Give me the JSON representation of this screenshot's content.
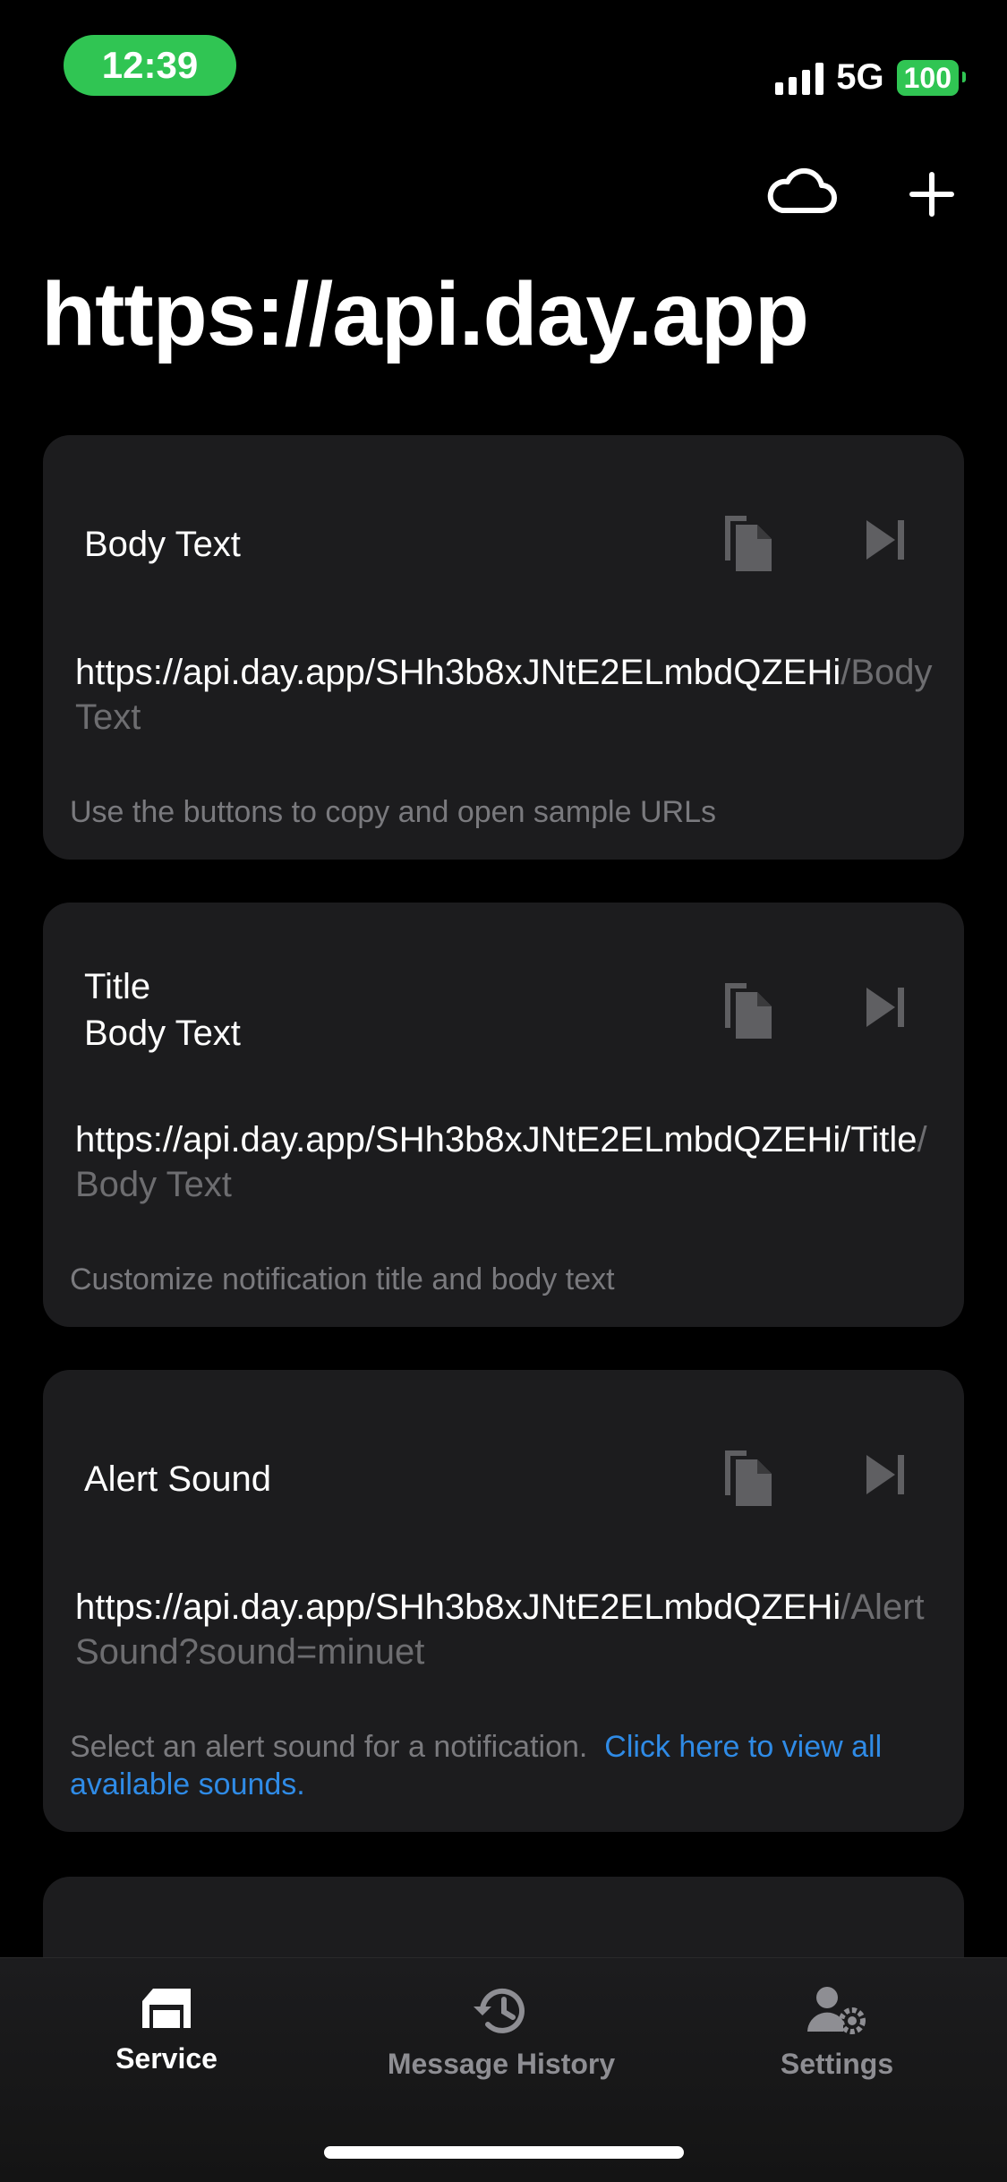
{
  "status": {
    "time": "12:39",
    "network": "5G",
    "battery": "100"
  },
  "header": {
    "title": "https://api.day.app"
  },
  "cards": [
    {
      "title": "Body Text",
      "url_base": "https://api.day.app/SHh3b8xJNtE2ELmbdQZEHi",
      "url_suffix": "/Body Text",
      "description": "Use the buttons to copy and open sample URLs"
    },
    {
      "title": "Title\nBody Text",
      "url_base": "https://api.day.app/SHh3b8xJNtE2ELmbdQZEHi/Title",
      "url_suffix": "/Body Text",
      "description": "Customize notification title and body text"
    },
    {
      "title": "Alert Sound",
      "url_base": "https://api.day.app/SHh3b8xJNtE2ELmbdQZEHi",
      "url_suffix": "/Alert Sound",
      "url_extra": "?sound=minuet",
      "description": "Select an alert sound for a notification.",
      "link": "Click here to view all available sounds."
    }
  ],
  "icons": {
    "cloud": "cloud-icon",
    "plus": "plus-icon",
    "copy": "copy-icon",
    "open": "skip-forward-icon",
    "service": "house-icon",
    "history": "history-icon",
    "settings": "person-gear-icon"
  },
  "tabs": [
    {
      "label": "Service",
      "selected": true
    },
    {
      "label": "Message History",
      "selected": false
    },
    {
      "label": "Settings",
      "selected": false
    }
  ],
  "colors": {
    "accent": "#30c553",
    "link": "#2f8be6",
    "card": "#1c1c1e",
    "muted": "#6d6d70"
  }
}
